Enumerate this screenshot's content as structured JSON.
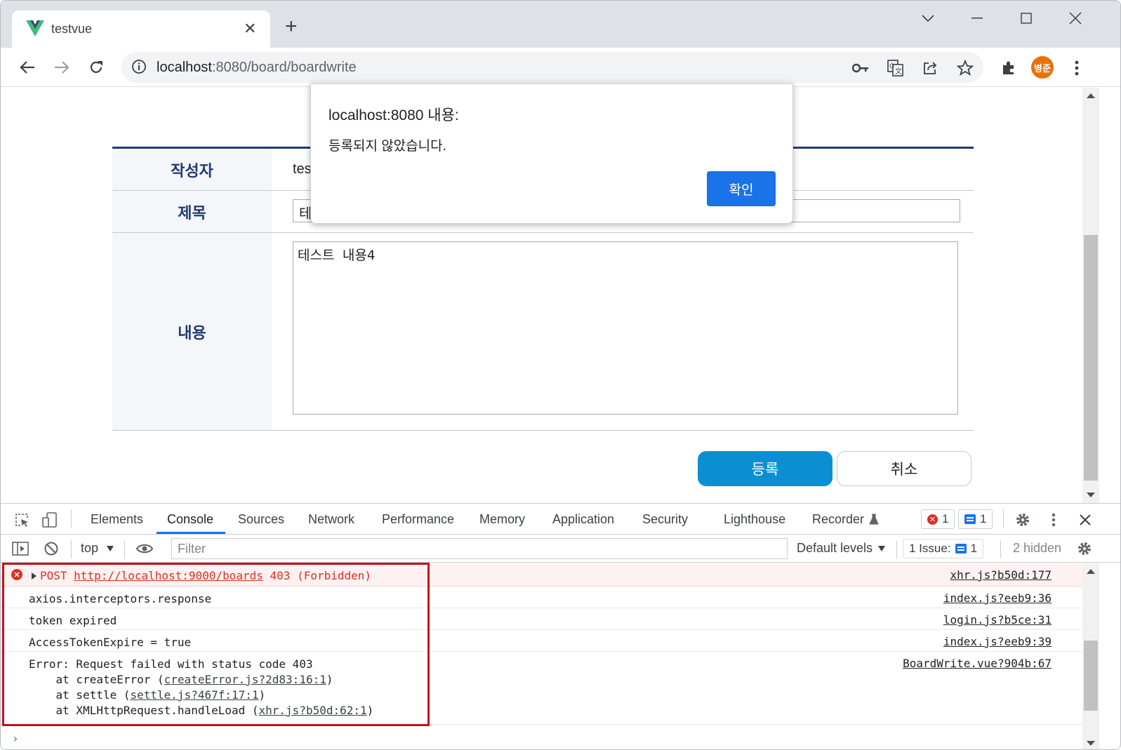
{
  "browser": {
    "tab_title": "testvue",
    "tab_close": "✕",
    "new_tab": "+",
    "url_host": "localhost",
    "url_path": ":8080/board/boardwrite",
    "profile_initials": "병준"
  },
  "form": {
    "labels": {
      "writer": "작성자",
      "title": "제목",
      "content": "내용"
    },
    "writer_value": "tes",
    "title_value": "테",
    "content_value": "테스트 내용4",
    "submit_label": "등록",
    "cancel_label": "취소"
  },
  "dialog": {
    "title": "localhost:8080 내용:",
    "message": "등록되지 않았습니다.",
    "ok_label": "확인"
  },
  "devtools": {
    "tabs": [
      "Elements",
      "Console",
      "Sources",
      "Network",
      "Performance",
      "Memory",
      "Application",
      "Security",
      "Lighthouse",
      "Recorder"
    ],
    "active_tab": "Console",
    "error_count": "1",
    "message_count": "1",
    "context": "top",
    "filter_placeholder": "Filter",
    "levels": "Default levels",
    "issues_label": "1 Issue:",
    "issues_count": "1",
    "hidden": "2 hidden",
    "console": [
      {
        "type": "error",
        "method": "POST",
        "url": "http://localhost:9000/boards",
        "status": "403 (Forbidden)",
        "source": "xhr.js?b50d:177"
      },
      {
        "type": "log",
        "text": "axios.interceptors.response",
        "source": "index.js?eeb9:36"
      },
      {
        "type": "log",
        "text": "token expired",
        "source": "login.js?b5ce:31"
      },
      {
        "type": "log",
        "text": "AccessTokenExpire = true",
        "source": "index.js?eeb9:39"
      },
      {
        "type": "log",
        "text": "Error: Request failed with status code 403",
        "source": "BoardWrite.vue?904b:67",
        "stack": [
          {
            "prefix": "    at createError (",
            "link": "createError.js?2d83:16:1",
            "suffix": ")"
          },
          {
            "prefix": "    at settle (",
            "link": "settle.js?467f:17:1",
            "suffix": ")"
          },
          {
            "prefix": "    at XMLHttpRequest.handleLoad (",
            "link": "xhr.js?b50d:62:1",
            "suffix": ")"
          }
        ]
      }
    ],
    "prompt": "›"
  }
}
